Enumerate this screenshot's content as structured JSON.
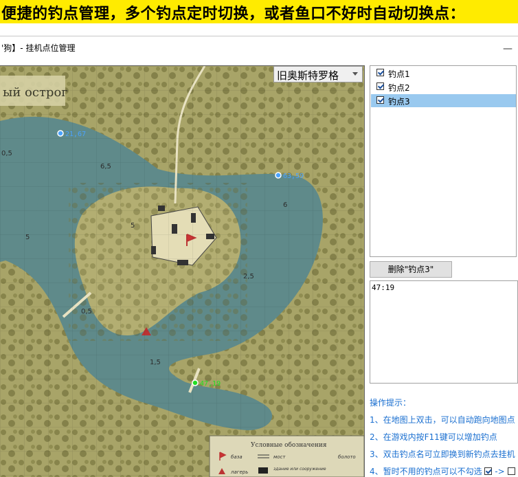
{
  "banner": {
    "text": "便捷的钓点管理，多个钓点定时切换，或者鱼口不好时自动切换点："
  },
  "window": {
    "title": "'狗】- 挂机点位管理",
    "minimize_glyph": "—"
  },
  "map": {
    "location_value": "旧奥斯特罗格",
    "map_title": "ый острог",
    "depth_labels": [
      "0,5",
      "6,5",
      "5",
      "5",
      "6",
      "2,5",
      "0,5",
      "1,5"
    ],
    "markers": [
      {
        "label": "21,67",
        "color": "#4aa3ff"
      },
      {
        "label": "63,59",
        "color": "#4aa3ff"
      },
      {
        "label": "47,19",
        "color": "#22dd22"
      }
    ],
    "legend": {
      "title": "Условные обозначения",
      "items": [
        "база",
        "мост",
        "болото",
        "лагерь",
        "здание или сооружение"
      ]
    }
  },
  "spots": {
    "items": [
      {
        "label": "钓点1",
        "checked": true,
        "selected": false
      },
      {
        "label": "钓点2",
        "checked": true,
        "selected": false
      },
      {
        "label": "钓点3",
        "checked": true,
        "selected": true
      }
    ]
  },
  "delete_button": {
    "label": "删除\"钓点3\""
  },
  "time_area": {
    "value": "47:19"
  },
  "tips": {
    "title": "操作提示：",
    "items": [
      "1、在地图上双击，可以自动跑向地图点",
      "2、在游戏内按F11键可以增加钓点",
      "3、双击钓点名可立即换到新钓点去挂机",
      "4、暂时不用的钓点可以不勾选"
    ],
    "arrow": "->"
  },
  "colors": {
    "banner": "#ffeb00",
    "selection": "#99c9ef",
    "tip_text": "#1a6fd0",
    "water": "#5f8a8a",
    "land": "#a8a468"
  }
}
